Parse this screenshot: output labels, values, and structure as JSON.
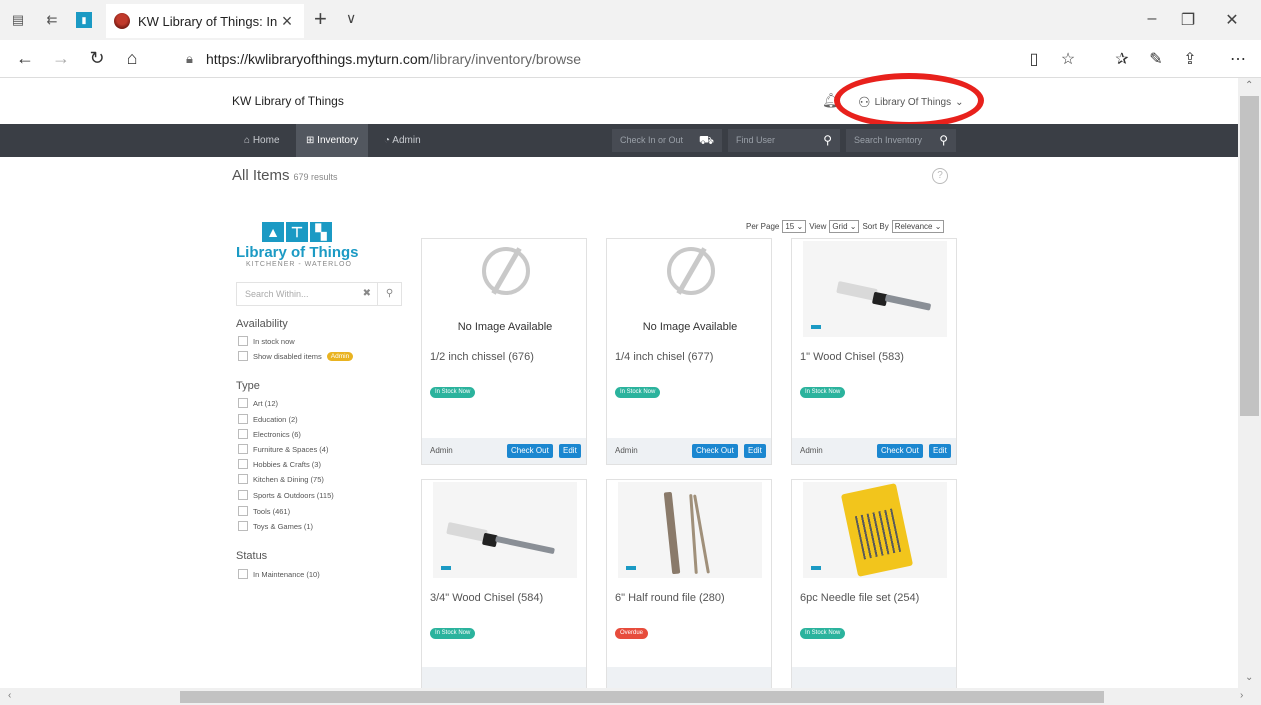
{
  "browser": {
    "tab_title": "KW Library of Things: In",
    "url_host": "https://kwlibraryofthings.myturn.com",
    "url_path": "/library/inventory/browse"
  },
  "site": {
    "title": "KW Library of Things",
    "user_menu": "Library Of Things"
  },
  "nav": {
    "home": "Home",
    "inventory": "Inventory",
    "admin": "Admin",
    "checkin_placeholder": "Check In or Out",
    "finduser_placeholder": "Find User",
    "search_placeholder": "Search Inventory"
  },
  "listing": {
    "heading": "All Items",
    "count": "679 results",
    "per_page_label": "Per Page",
    "per_page_value": "15",
    "view_label": "View",
    "view_value": "Grid",
    "sort_label": "Sort By",
    "sort_value": "Relevance"
  },
  "sidebar": {
    "logo_name": "Library of Things",
    "logo_sub": "KITCHENER - WATERLOO",
    "search_placeholder": "Search Within...",
    "availability_heading": "Availability",
    "availability": [
      {
        "label": "In stock now"
      },
      {
        "label": "Show disabled items",
        "badge": "Admin"
      }
    ],
    "type_heading": "Type",
    "types": [
      {
        "label": "Art (12)"
      },
      {
        "label": "Education (2)"
      },
      {
        "label": "Electronics (6)"
      },
      {
        "label": "Furniture & Spaces (4)"
      },
      {
        "label": "Hobbies & Crafts (3)"
      },
      {
        "label": "Kitchen & Dining (75)"
      },
      {
        "label": "Sports & Outdoors (115)"
      },
      {
        "label": "Tools (461)"
      },
      {
        "label": "Toys & Games (1)"
      }
    ],
    "status_heading": "Status",
    "statuses": [
      {
        "label": "In Maintenance (10)"
      }
    ]
  },
  "items": [
    {
      "name": "1/2 inch chissel (676)",
      "status": "In Stock Now",
      "no_image": "No Image Available",
      "owner": "Admin",
      "checkout": "Check Out",
      "edit": "Edit"
    },
    {
      "name": "1/4 inch chisel (677)",
      "status": "In Stock Now",
      "no_image": "No Image Available",
      "owner": "Admin",
      "checkout": "Check Out",
      "edit": "Edit"
    },
    {
      "name": "1\" Wood Chisel (583)",
      "status": "In Stock Now",
      "owner": "Admin",
      "checkout": "Check Out",
      "edit": "Edit"
    },
    {
      "name": "3/4\" Wood Chisel (584)",
      "status": "In Stock Now"
    },
    {
      "name": "6\" Half round file (280)",
      "status": "Overdue"
    },
    {
      "name": "6pc Needle file set (254)",
      "status": "In Stock Now"
    }
  ]
}
